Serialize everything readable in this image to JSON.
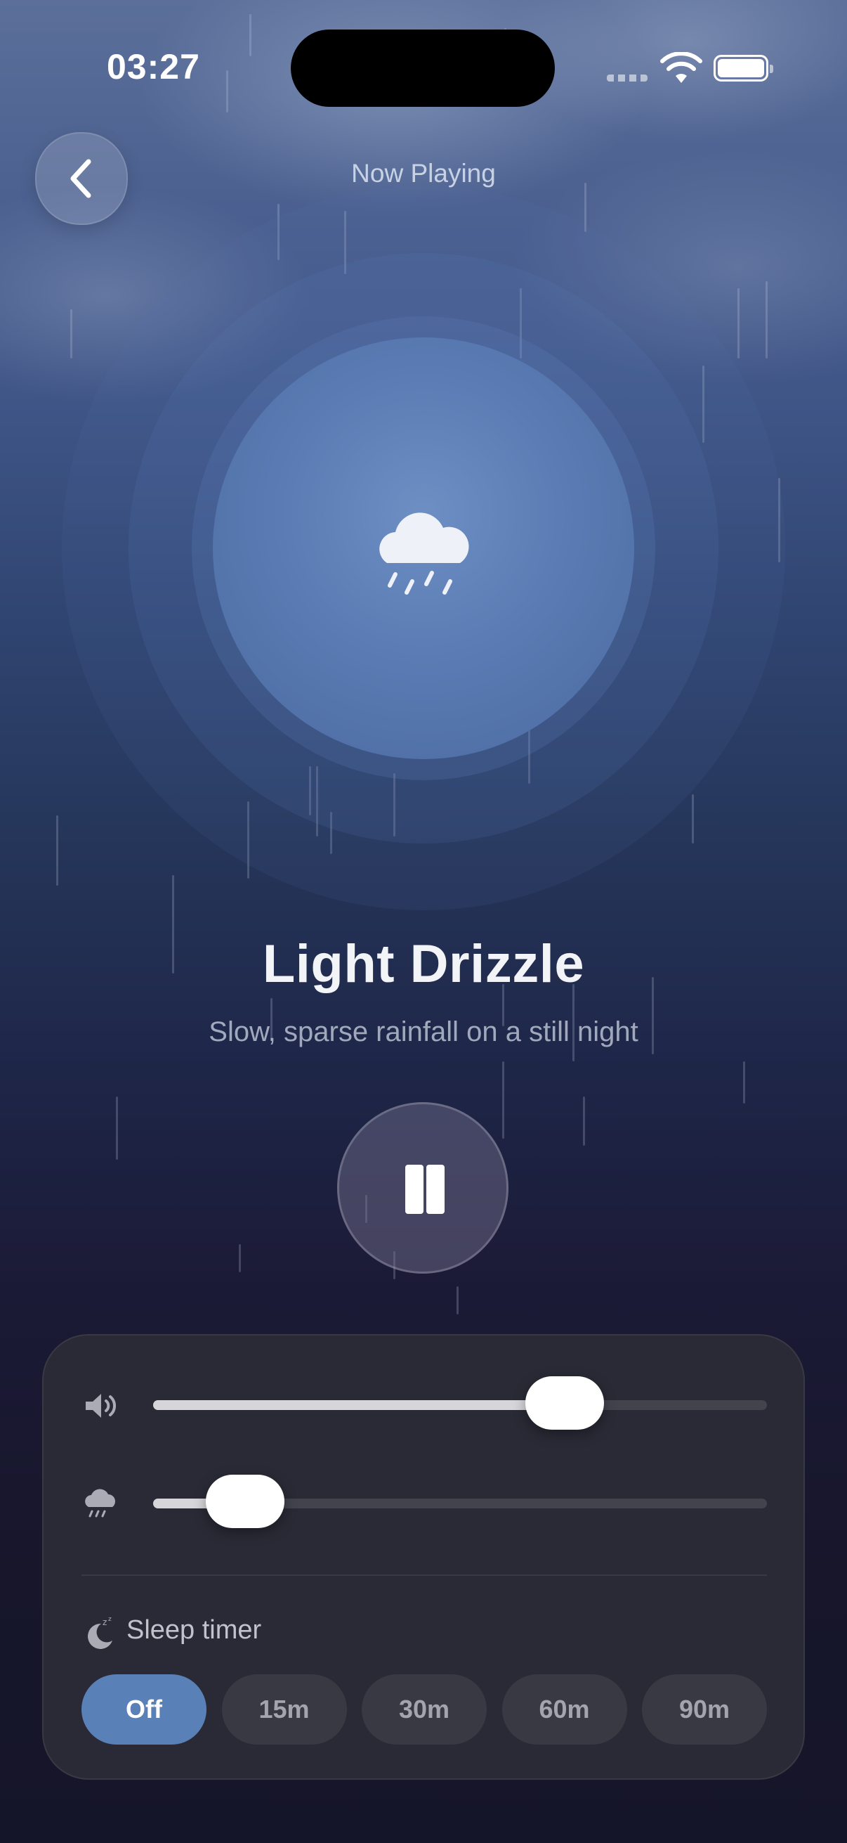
{
  "status_bar": {
    "time": "03:27"
  },
  "header": {
    "title": "Now Playing",
    "back_icon": "chevron-left-icon"
  },
  "track": {
    "icon": "cloud-rain-icon",
    "title": "Light Drizzle",
    "subtitle": "Slow, sparse rainfall on a still night",
    "state": "playing"
  },
  "controls": {
    "volume": {
      "icon": "speaker-icon",
      "value": 0.67
    },
    "rain_intensity": {
      "icon": "cloud-rain-icon",
      "value": 0.15
    }
  },
  "sleep_timer": {
    "label": "Sleep timer",
    "icon": "moon-zzz-icon",
    "options": [
      "Off",
      "15m",
      "30m",
      "60m",
      "90m"
    ],
    "selected": "Off"
  },
  "colors": {
    "accent": "#5a80b8",
    "panel": "#2a2a36"
  }
}
